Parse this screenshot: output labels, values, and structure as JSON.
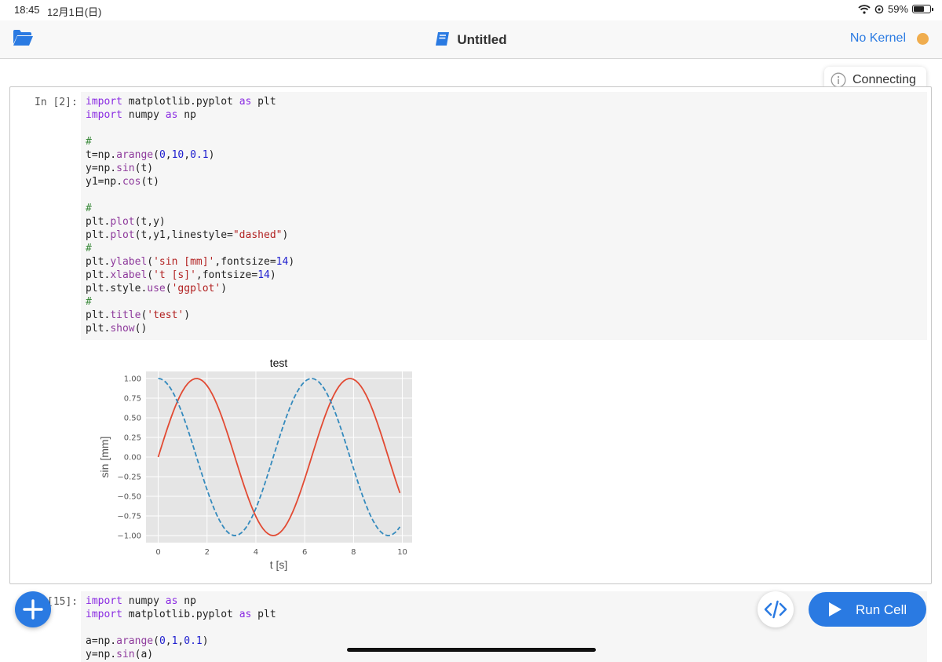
{
  "status_bar": {
    "time": "18:45",
    "date": "12月1日(日)",
    "battery": "59%"
  },
  "navbar": {
    "title": "Untitled",
    "kernel_label": "No Kernel",
    "kernel_color": "#f0ad4e"
  },
  "toast": {
    "label": "Connecting"
  },
  "cells": [
    {
      "prompt": "In [2]:",
      "lines": [
        "import matplotlib.pyplot as plt",
        "import numpy as np",
        "",
        "#",
        "t=np.arange(0,10,0.1)",
        "y=np.sin(t)",
        "y1=np.cos(t)",
        "",
        "#",
        "plt.plot(t,y)",
        "plt.plot(t,y1,linestyle=\"dashed\")",
        "#",
        "plt.ylabel('sin [mm]',fontsize=14)",
        "plt.xlabel('t [s]',fontsize=14)",
        "plt.style.use('ggplot')",
        "#",
        "plt.title('test')",
        "plt.show()"
      ]
    },
    {
      "prompt": "[15]:",
      "lines": [
        "import numpy as np",
        "import matplotlib.pyplot as plt",
        "",
        "a=np.arange(0,1,0.1)",
        "y=np.sin(a)"
      ]
    }
  ],
  "chart_data": {
    "type": "line",
    "title": "test",
    "xlabel": "t [s]",
    "ylabel": "sin [mm]",
    "xlim": [
      -0.5,
      10.4
    ],
    "ylim": [
      -1.09,
      1.09
    ],
    "xticks": [
      0,
      2,
      4,
      6,
      8,
      10
    ],
    "yticks": [
      1.0,
      0.75,
      0.5,
      0.25,
      0.0,
      -0.25,
      -0.5,
      -0.75,
      -1.0
    ],
    "ytick_labels": [
      "1.00",
      "0.75",
      "0.50",
      "0.25",
      "0.00",
      "−0.25",
      "−0.50",
      "−0.75",
      "−1.00"
    ],
    "grid": true,
    "x": {
      "start": 0,
      "stop": 10,
      "step": 0.1
    },
    "series": [
      {
        "function": "sin",
        "color": "#e24a33",
        "linestyle": "solid"
      },
      {
        "function": "cos",
        "color": "#348abd",
        "linestyle": "dashed"
      }
    ],
    "background": "#e5e5e5"
  },
  "buttons": {
    "run_cell": "Run Cell"
  },
  "colors": {
    "accent": "#2a7ae2",
    "code_bg": "#f6f6f6"
  },
  "icons": [
    "folder-icon",
    "notebook-icon",
    "info-icon",
    "plus-icon",
    "code-icon",
    "play-icon",
    "wifi-icon",
    "battery-icon"
  ]
}
